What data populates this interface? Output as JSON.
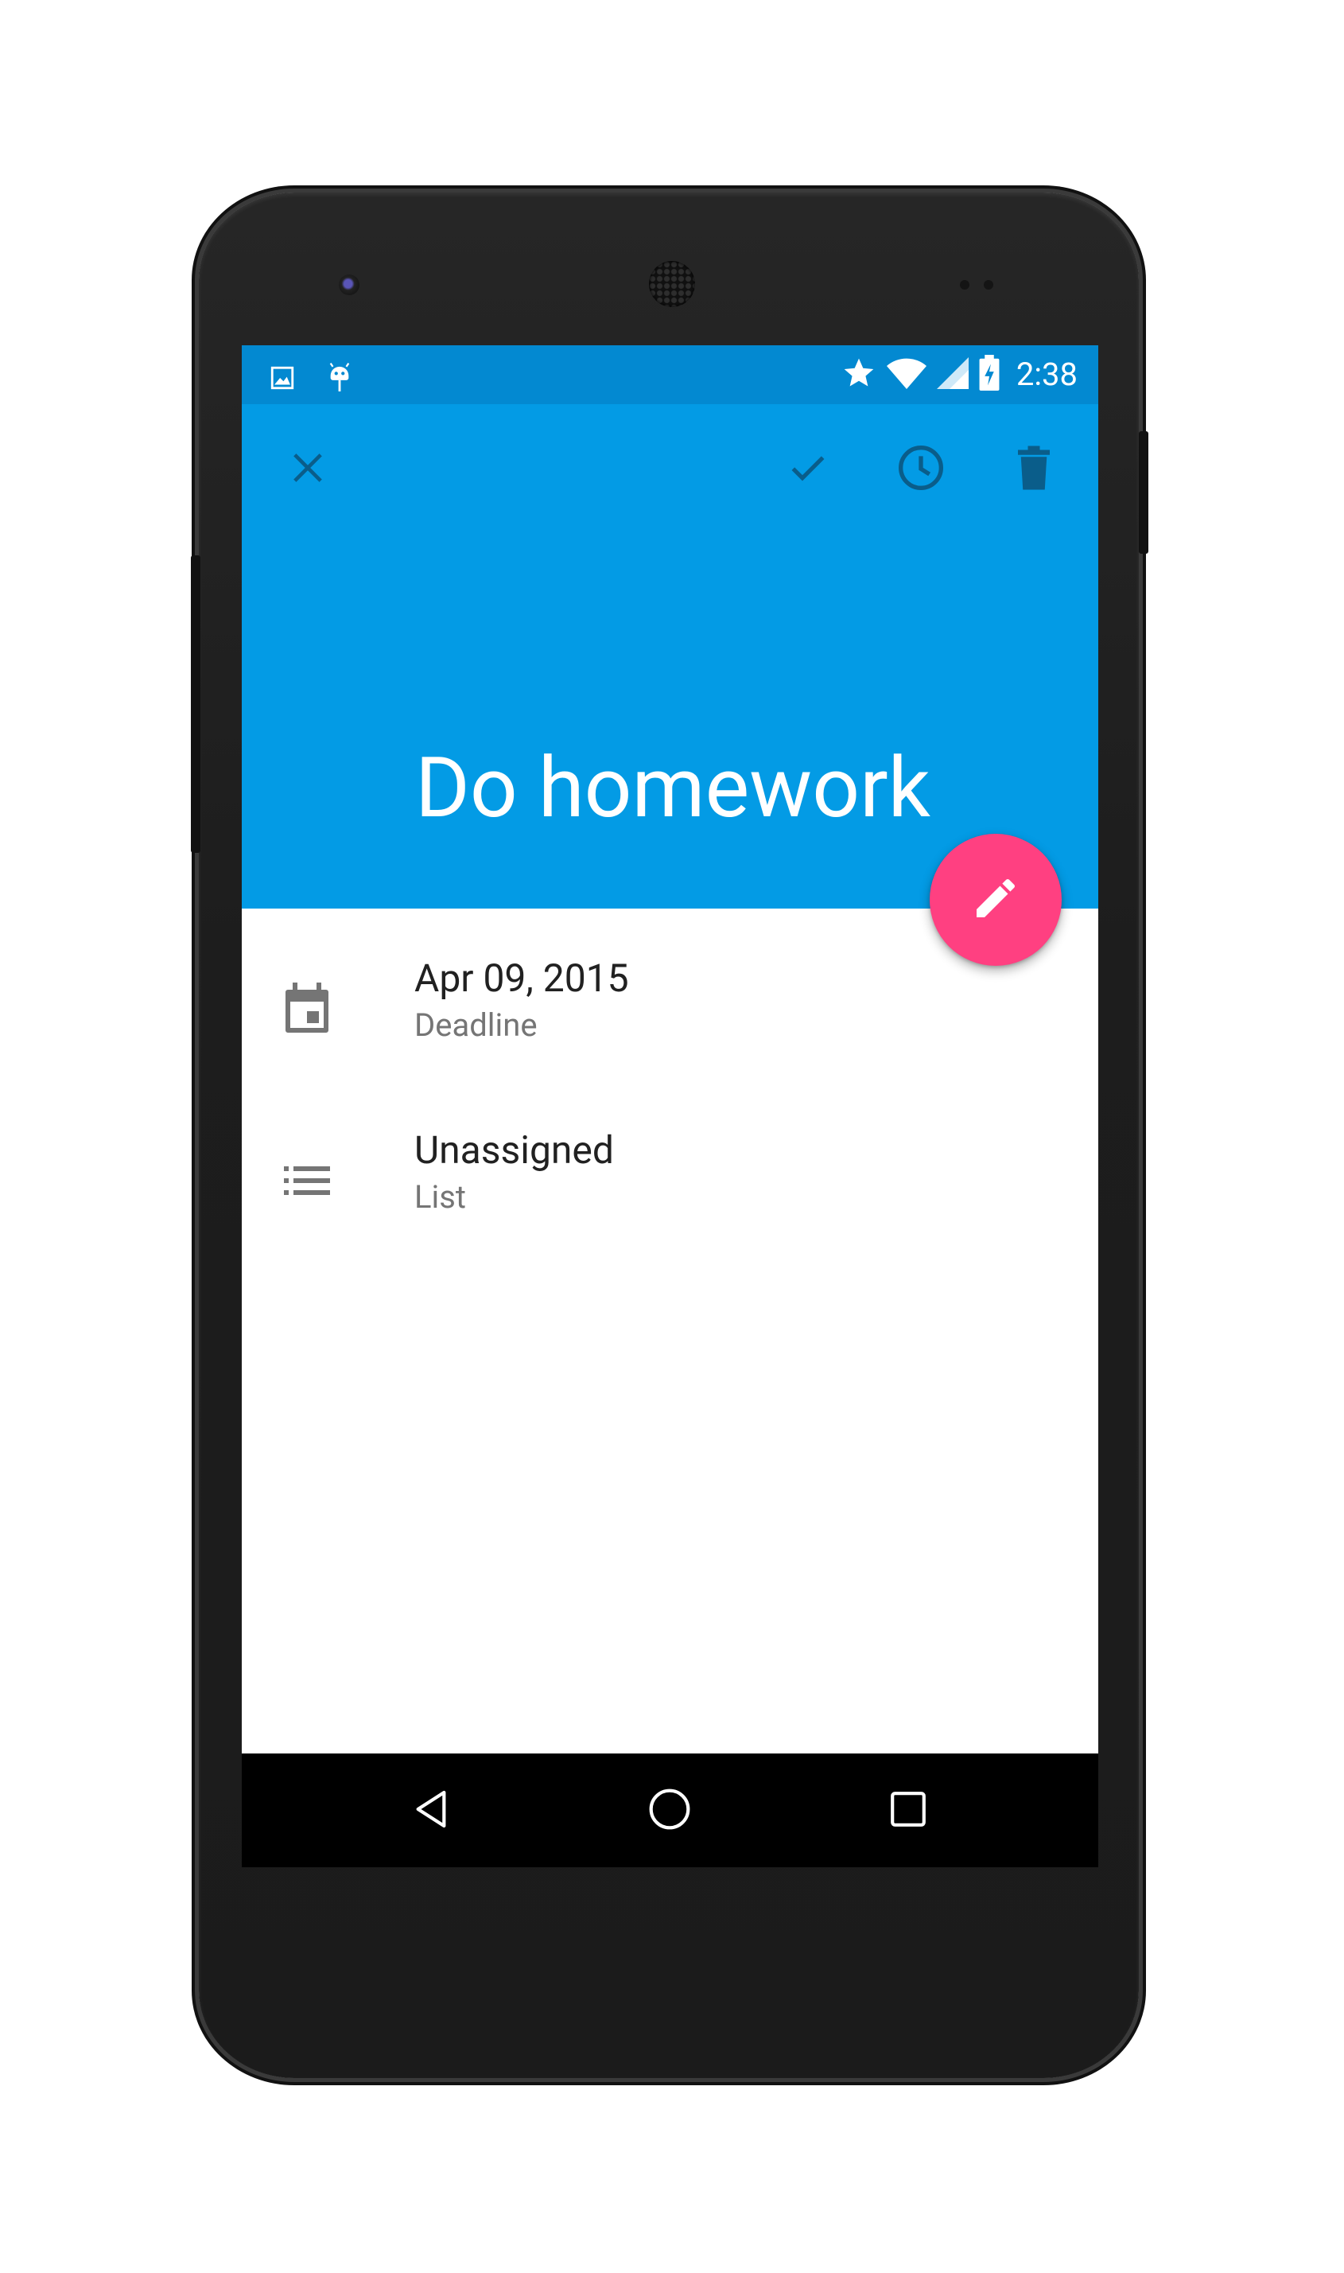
{
  "status_bar": {
    "time": "2:38",
    "background": "#0389D1",
    "left_icons": [
      "image-notification-icon",
      "android-debug-icon"
    ],
    "right_icons": [
      "star-icon",
      "wifi-icon",
      "cell-signal-icon",
      "battery-charging-icon"
    ]
  },
  "toolbar": {
    "close_icon": "close-icon",
    "actions": [
      "check-icon",
      "clock-icon",
      "trash-icon"
    ],
    "background": "#039BE5"
  },
  "task": {
    "title": "Do homework"
  },
  "fab": {
    "icon": "pencil-icon",
    "color": "#FF4081"
  },
  "details": [
    {
      "icon": "calendar-icon",
      "primary": "Apr 09, 2015",
      "secondary": "Deadline"
    },
    {
      "icon": "list-icon",
      "primary": "Unassigned",
      "secondary": "List"
    }
  ],
  "nav_bar": {
    "buttons": [
      "back-icon",
      "home-icon",
      "recents-icon"
    ]
  }
}
